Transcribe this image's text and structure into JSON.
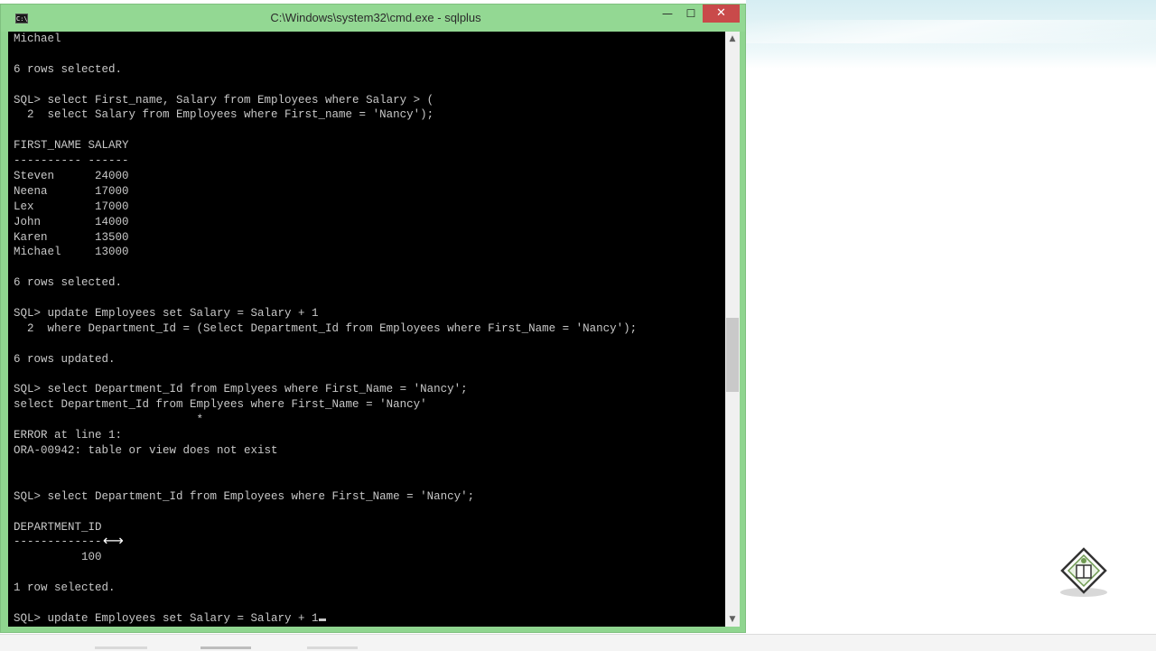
{
  "window": {
    "title": "C:\\Windows\\system32\\cmd.exe - sqlplus",
    "icon_label": "C:\\",
    "minimize": "—",
    "maximize": "☐",
    "close": "✕"
  },
  "console": {
    "lines": [
      "Michael",
      "",
      "6 rows selected.",
      "",
      "SQL> select First_name, Salary from Employees where Salary > (",
      "  2  select Salary from Employees where First_name = 'Nancy');",
      "",
      "FIRST_NAME SALARY",
      "---------- ------",
      "Steven      24000",
      "Neena       17000",
      "Lex         17000",
      "John        14000",
      "Karen       13500",
      "Michael     13000",
      "",
      "6 rows selected.",
      "",
      "SQL> update Employees set Salary = Salary + 1",
      "  2  where Department_Id = (Select Department_Id from Employees where First_Name = 'Nancy');",
      "",
      "6 rows updated.",
      "",
      "SQL> select Department_Id from Emplyees where First_Name = 'Nancy';",
      "select Department_Id from Emplyees where First_Name = 'Nancy'",
      "                           *",
      "ERROR at line 1:",
      "ORA-00942: table or view does not exist",
      "",
      "",
      "SQL> select Department_Id from Employees where First_Name = 'Nancy';",
      "",
      "DEPARTMENT_ID",
      "-------------",
      "          100",
      "",
      "1 row selected.",
      "",
      "SQL> update Employees set Salary = Salary + 1"
    ]
  },
  "scrollbar": {
    "up": "▲",
    "down": "▼"
  },
  "pointer": "⟷",
  "colors": {
    "title_bar": "#93d893",
    "close_button": "#c94a4a",
    "console_bg": "#000000",
    "console_text": "#c8c8c8"
  },
  "icons": {
    "app": "cmd-icon",
    "logo": "tutorialspoint-logo-icon",
    "pointer": "resize-cursor-icon"
  }
}
